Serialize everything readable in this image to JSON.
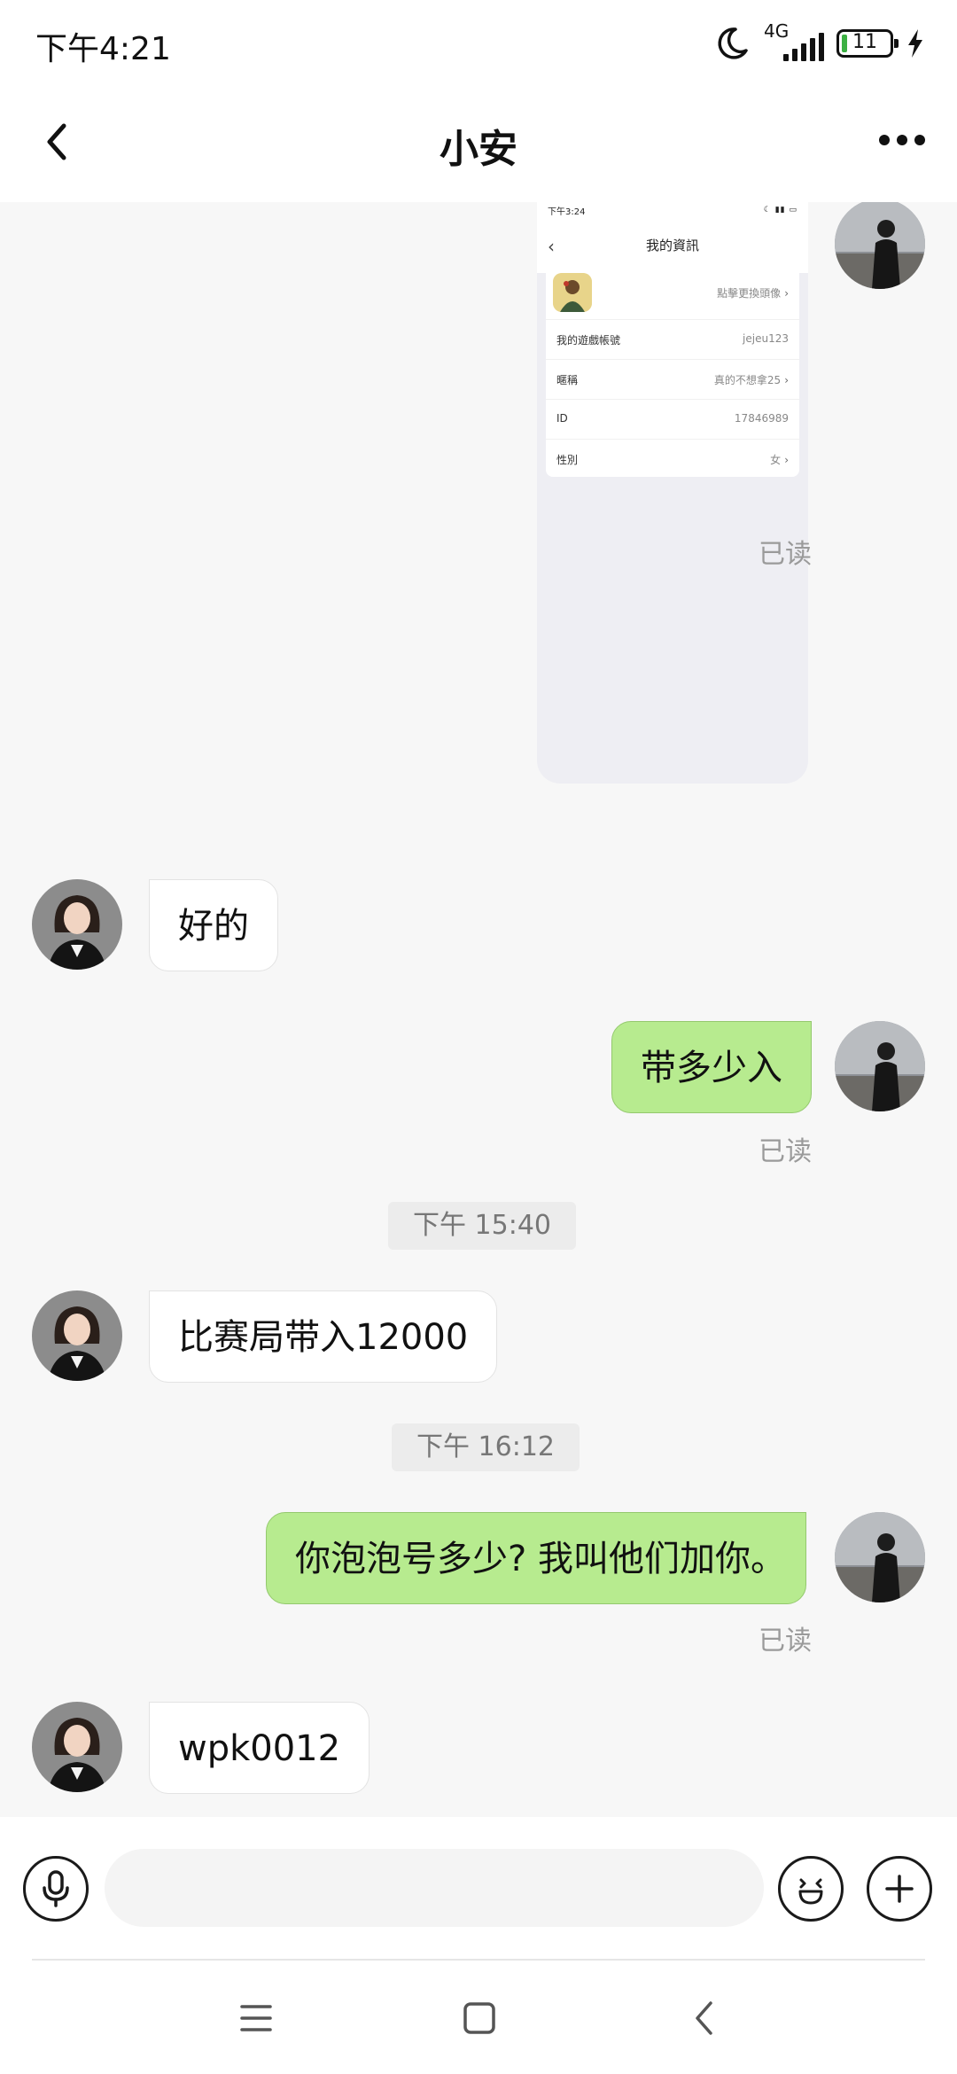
{
  "status_bar": {
    "time": "下午4:21",
    "network": "4G",
    "battery": "11",
    "battery_level": 0.11
  },
  "header": {
    "title": "小安"
  },
  "shared_screenshot": {
    "time": "下午3:24",
    "title": "我的資訊",
    "avatar_action": "點擊更換頭像",
    "rows": [
      {
        "key": "我的遊戲帳號",
        "value": "jejeu123"
      },
      {
        "key": "暱稱",
        "value": "真的不想拿25"
      },
      {
        "key": "ID",
        "value": "17846989"
      },
      {
        "key": "性別",
        "value": "女"
      }
    ]
  },
  "messages": {
    "read_label": "已读",
    "m1": "好的",
    "m2": "带多少入",
    "ts1": "下午 15:40",
    "m3": "比赛局带入12000",
    "ts2": "下午 16:12",
    "m4": "你泡泡号多少? 我叫他们加你。",
    "m5": "wpk0012"
  },
  "colors": {
    "sent_bubble": "#b7eb8f",
    "received_bubble": "#ffffff",
    "background": "#f7f7f7"
  }
}
